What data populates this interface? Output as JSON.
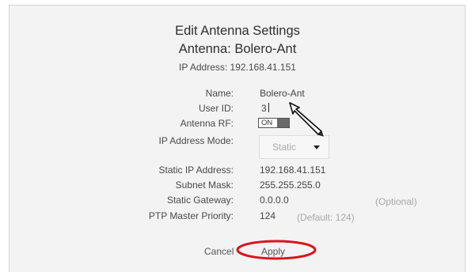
{
  "dialog": {
    "title": "Edit Antenna Settings",
    "antenna_line": "Antenna: Bolero-Ant",
    "ip_line": "IP Address: 192.168.41.151"
  },
  "form": {
    "name": {
      "label": "Name:",
      "value": "Bolero-Ant"
    },
    "user_id": {
      "label": "User ID:",
      "value": "3"
    },
    "antenna_rf": {
      "label": "Antenna RF:",
      "state": "ON"
    },
    "ip_address_mode": {
      "label": "IP Address Mode:",
      "selected": "Static"
    },
    "static_ip": {
      "label": "Static IP Address:",
      "value": "192.168.41.151"
    },
    "subnet_mask": {
      "label": "Subnet Mask:",
      "value": "255.255.255.0"
    },
    "static_gateway": {
      "label": "Static Gateway:",
      "value": "0.0.0.0",
      "hint": "(Optional)"
    },
    "ptp_priority": {
      "label": "PTP Master Priority:",
      "value": "124",
      "hint": "(Default: 124)"
    }
  },
  "buttons": {
    "cancel": "Cancel",
    "apply": "Apply"
  },
  "colors": {
    "annotation_red": "#d9141c",
    "panel_bg": "#f3f3f3"
  },
  "icons": {
    "cursor": "mouse-pointer-icon",
    "dropdown": "chevron-down-icon"
  }
}
